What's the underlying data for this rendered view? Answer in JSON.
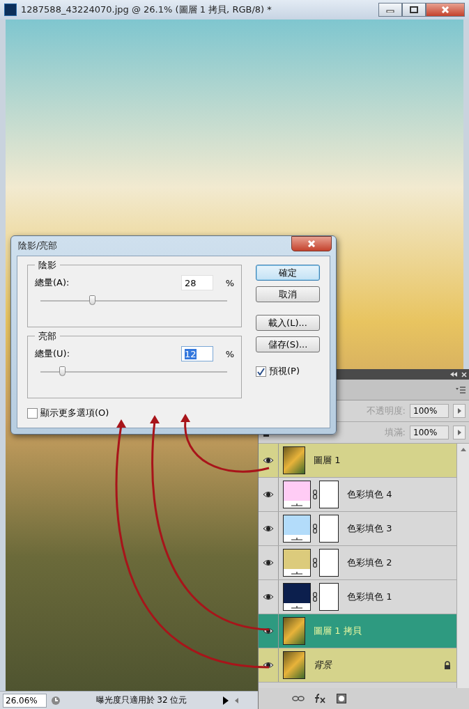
{
  "window": {
    "title": "1287588_43224070.jpg @ 26.1% (圖層 1 拷貝, RGB/8) *"
  },
  "dialog": {
    "title": "陰影/亮部",
    "groups": [
      {
        "legend": "陰影",
        "label": "總量(A):",
        "value": "28",
        "unit": "%",
        "level": 0.28,
        "selected": false
      },
      {
        "legend": "亮部",
        "label": "總量(U):",
        "value": "12",
        "unit": "%",
        "level": 0.12,
        "selected": true
      }
    ],
    "button_groups": [
      [
        {
          "label": "確定",
          "default": true
        },
        {
          "label": "取消",
          "default": false
        }
      ],
      [
        {
          "label": "載入(L)...",
          "default": false
        },
        {
          "label": "儲存(S)...",
          "default": false
        }
      ]
    ],
    "preview": {
      "label": "預視(P)",
      "checked": true
    },
    "more_options": {
      "label": "顯示更多選項(O)",
      "checked": false
    }
  },
  "layers_panel": {
    "opacity": {
      "label": "不透明度:",
      "value": "100%",
      "disabled": true
    },
    "fill": {
      "label": "填滿:",
      "value": "100%",
      "disabled": true
    },
    "layers": [
      {
        "kind": "image",
        "name": "圖層 1",
        "visible": true,
        "selected": false,
        "locked": false,
        "color": "#d5d38b"
      },
      {
        "kind": "fill",
        "name": "色彩填色 4",
        "visible": true,
        "selected": false,
        "locked": false,
        "color": "#ffccf5"
      },
      {
        "kind": "fill",
        "name": "色彩填色 3",
        "visible": true,
        "selected": false,
        "locked": false,
        "color": "#b3dcfa"
      },
      {
        "kind": "fill",
        "name": "色彩填色 2",
        "visible": true,
        "selected": false,
        "locked": false,
        "color": "#dccb7c"
      },
      {
        "kind": "fill",
        "name": "色彩填色 1",
        "visible": true,
        "selected": false,
        "locked": false,
        "color": "#0c1f4d"
      },
      {
        "kind": "image",
        "name": "圖層 1 拷貝",
        "visible": true,
        "selected": true,
        "locked": false
      },
      {
        "kind": "image",
        "name": "背景",
        "visible": true,
        "selected": false,
        "locked": true,
        "color": "#d5d38b"
      }
    ]
  },
  "status_bar": {
    "zoom": "26.06%",
    "info": "曝光度只適用於 32 位元"
  }
}
